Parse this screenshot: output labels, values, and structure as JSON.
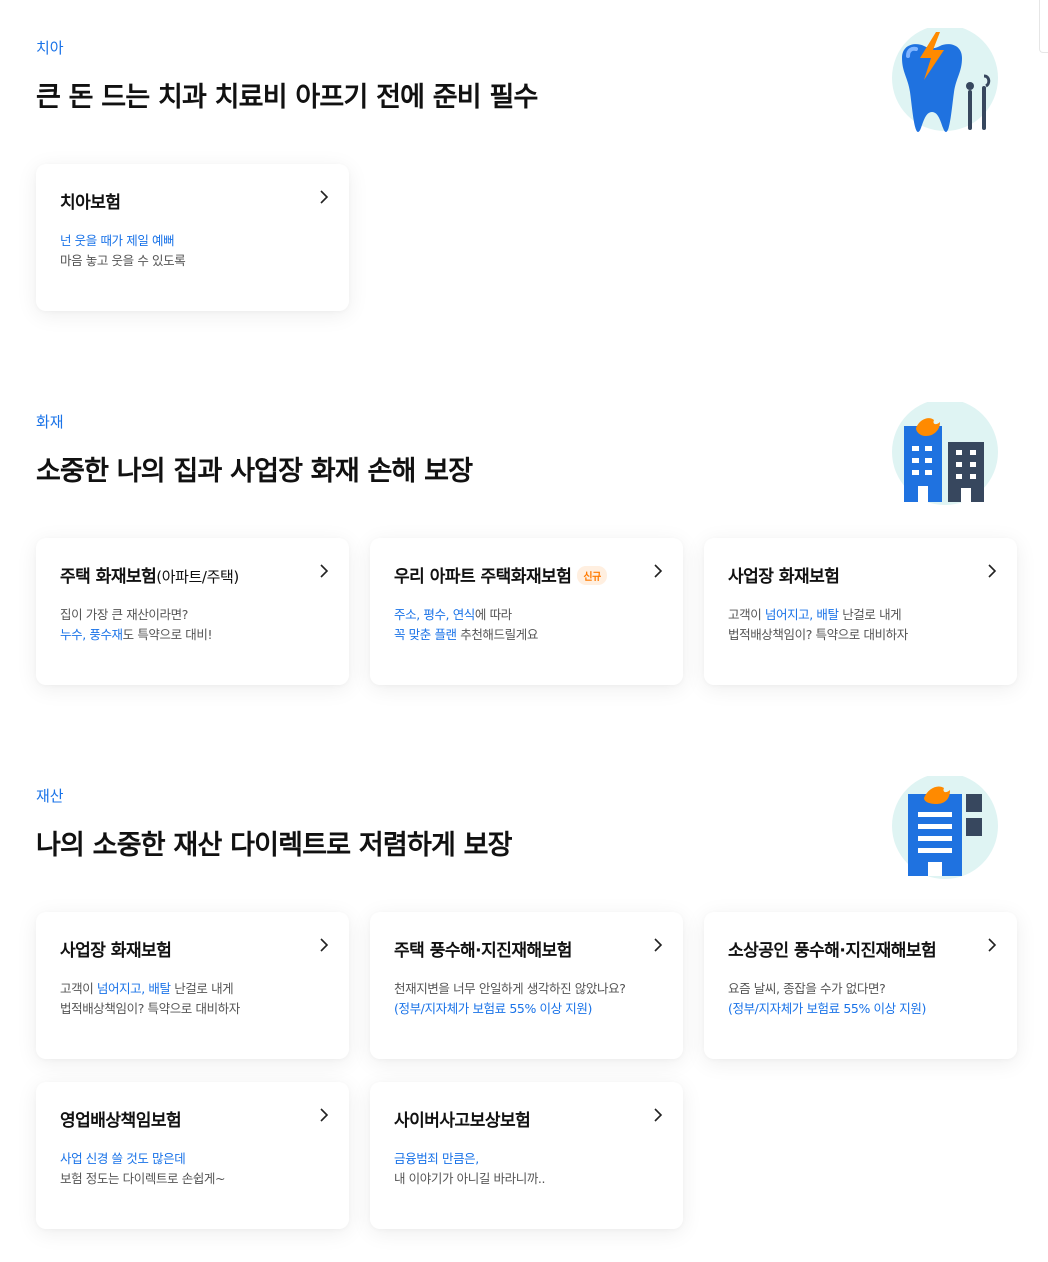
{
  "sections": [
    {
      "category": "치아",
      "headline": "큰 돈 드는 치과 치료비 아프기 전에 준비 필수",
      "icon": "tooth-dental-icon",
      "cards": [
        {
          "title": "치아보험",
          "lines": [
            [
              {
                "t": "넌 웃을 때가 제일 예뻐",
                "b": true
              }
            ],
            [
              {
                "t": "마음 놓고 웃을 수 있도록",
                "b": false
              }
            ]
          ]
        }
      ]
    },
    {
      "category": "화재",
      "headline": "소중한 나의 집과 사업장 화재 손해 보장",
      "icon": "burning-buildings-icon",
      "cards": [
        {
          "title": "주택 화재보험",
          "title_sub": "(아파트/주택)",
          "lines": [
            [
              {
                "t": "집이 가장 큰 재산이라면?",
                "b": false
              }
            ],
            [
              {
                "t": "누수, 풍수재",
                "b": true
              },
              {
                "t": "도 특약으로 대비!",
                "b": false
              }
            ]
          ]
        },
        {
          "title": "우리 아파트 주택화재보험",
          "badge": "신규",
          "lines": [
            [
              {
                "t": "주소, 평수, 연식",
                "b": true
              },
              {
                "t": "에 따라",
                "b": false
              }
            ],
            [
              {
                "t": "꼭 맞춘 플랜",
                "b": true
              },
              {
                "t": " 추천해드릴게요",
                "b": false
              }
            ]
          ]
        },
        {
          "title": "사업장 화재보험",
          "lines": [
            [
              {
                "t": "고객이 ",
                "b": false
              },
              {
                "t": "넘어지고, 배탈",
                "b": true
              },
              {
                "t": " 난걸로 내게",
                "b": false
              }
            ],
            [
              {
                "t": "법적배상책임이? 특약으로 대비하자",
                "b": false
              }
            ]
          ]
        }
      ]
    },
    {
      "category": "재산",
      "headline": "나의 소중한 재산 다이렉트로 저렴하게 보장",
      "icon": "burning-office-icon",
      "cards": [
        {
          "title": "사업장 화재보험",
          "lines": [
            [
              {
                "t": "고객이 ",
                "b": false
              },
              {
                "t": "넘어지고, 배탈",
                "b": true
              },
              {
                "t": " 난걸로 내게",
                "b": false
              }
            ],
            [
              {
                "t": "법적배상책임이? 특약으로 대비하자",
                "b": false
              }
            ]
          ]
        },
        {
          "title": "주택 풍수해·지진재해보험",
          "lines": [
            [
              {
                "t": "천재지변을 너무 안일하게 생각하진 않았나요?",
                "b": false
              }
            ],
            [
              {
                "t": "(정부/지자체가 보험료 55% 이상 지원)",
                "b": true
              }
            ]
          ]
        },
        {
          "title": "소상공인 풍수해·지진재해보험",
          "lines": [
            [
              {
                "t": "요즘 날씨, 종잡을 수가 없다면?",
                "b": false
              }
            ],
            [
              {
                "t": "(정부/지자체가 보험료 55% 이상 지원)",
                "b": true
              }
            ]
          ]
        },
        {
          "title": "영업배상책임보험",
          "lines": [
            [
              {
                "t": "사업 신경 쓸 것도 많은데",
                "b": true
              }
            ],
            [
              {
                "t": "보험 정도는 다이렉트로 손쉽게~",
                "b": false
              }
            ]
          ]
        },
        {
          "title": "사이버사고보상보험",
          "lines": [
            [
              {
                "t": "금융범죄 만큼은,",
                "b": true
              }
            ],
            [
              {
                "t": "내 이야기가 아니길 바라니까..",
                "b": false
              }
            ]
          ]
        }
      ]
    }
  ],
  "colors": {
    "accent": "#1a73e8",
    "badge": "#ff7a00",
    "illustration_bg": "#dff4f3"
  }
}
